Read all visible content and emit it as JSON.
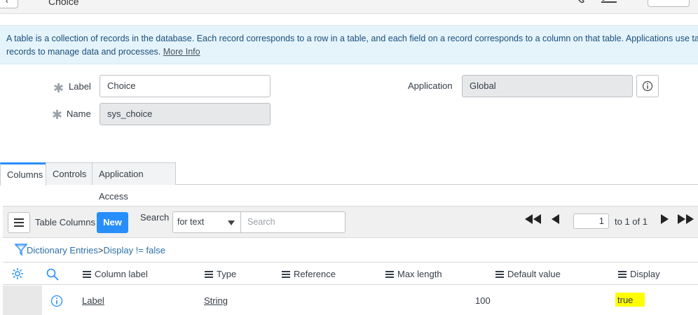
{
  "header": {
    "title": "Choice"
  },
  "banner": {
    "text": "A table is a collection of records in the database. Each record corresponds to a row in a table, and each field on a record corresponds to a column on that table. Applications use tables and",
    "text2": "records to manage data and processes.",
    "more_info": "More Info"
  },
  "form": {
    "label_label": "Label",
    "label_value": "Choice",
    "name_label": "Name",
    "name_value": "sys_choice",
    "application_label": "Application",
    "application_value": "Global"
  },
  "tabs": [
    {
      "label": "Columns",
      "active": true
    },
    {
      "label": "Controls",
      "active": false
    },
    {
      "label": "Application Access",
      "active": false
    }
  ],
  "list": {
    "title": "Table Columns",
    "new_label": "New",
    "search_label": "Search",
    "search_field": "for text",
    "search_placeholder": "Search",
    "page_value": "1",
    "page_of": "to 1 of 1"
  },
  "breadcrumb": {
    "root": "Dictionary Entries",
    "separator": ">",
    "filter": "Display != false"
  },
  "columns": [
    "Column label",
    "Type",
    "Reference",
    "Max length",
    "Default value",
    "Display"
  ],
  "rows": [
    {
      "column_label": "Label",
      "type": "String",
      "reference": "",
      "max_length": "100",
      "default_value": "",
      "display": "true"
    }
  ],
  "colors": {
    "accent": "#278efc",
    "banner_bg": "#e5f3fb",
    "highlight": "#ffff00"
  }
}
